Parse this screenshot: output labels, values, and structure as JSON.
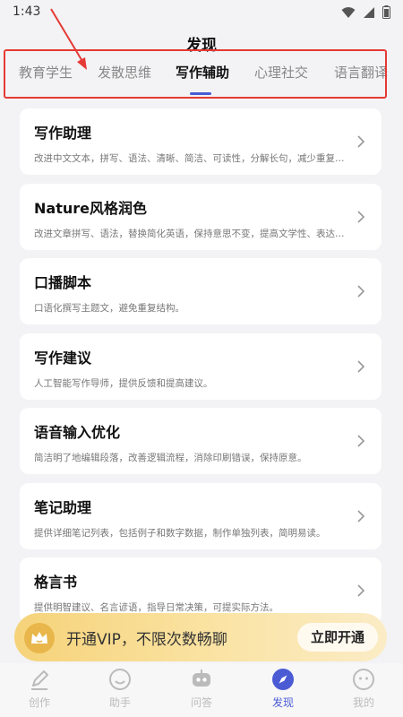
{
  "status_bar": {
    "time": "1:43"
  },
  "header": {
    "title": "发现"
  },
  "tabs": [
    {
      "label": "教育学生",
      "active": false
    },
    {
      "label": "发散思维",
      "active": false
    },
    {
      "label": "写作辅助",
      "active": true
    },
    {
      "label": "心理社交",
      "active": false
    },
    {
      "label": "语言翻译",
      "active": false
    }
  ],
  "cards": [
    {
      "title": "写作助理",
      "desc": "改进中文文本，拼写、语法、清晰、简洁、可读性，分解长句，减少重复，..."
    },
    {
      "title": "Nature风格润色",
      "desc": "改进文章拼写、语法，替换简化英语，保持意思不变，提高文学性、表达水..."
    },
    {
      "title": "口播脚本",
      "desc": "口语化撰写主题文，避免重复结构。"
    },
    {
      "title": "写作建议",
      "desc": "人工智能写作导师，提供反馈和提高建议。"
    },
    {
      "title": "语音输入优化",
      "desc": "简洁明了地编辑段落，改善逻辑流程，消除印刷错误，保持原意。"
    },
    {
      "title": "笔记助理",
      "desc": "提供详细笔记列表，包括例子和数字数据，制作单独列表，简明易读。"
    },
    {
      "title": "格言书",
      "desc": "提供明智建议、名言谚语，指导日常决策，可提实际方法。"
    }
  ],
  "vip_banner": {
    "text": "开通VIP，不限次数畅聊",
    "button_label": "立即开通"
  },
  "bottom_nav": [
    {
      "label": "创作",
      "icon": "pencil-icon",
      "active": false
    },
    {
      "label": "助手",
      "icon": "smiley-icon",
      "active": false
    },
    {
      "label": "问答",
      "icon": "robot-icon",
      "active": false
    },
    {
      "label": "发现",
      "icon": "compass-icon",
      "active": true
    },
    {
      "label": "我的",
      "icon": "profile-face-icon",
      "active": false
    }
  ],
  "colors": {
    "accent": "#4a5bd4",
    "annotation_red": "#e53935",
    "vip_gold": "#f6d37a",
    "background": "#f3f3f5"
  }
}
